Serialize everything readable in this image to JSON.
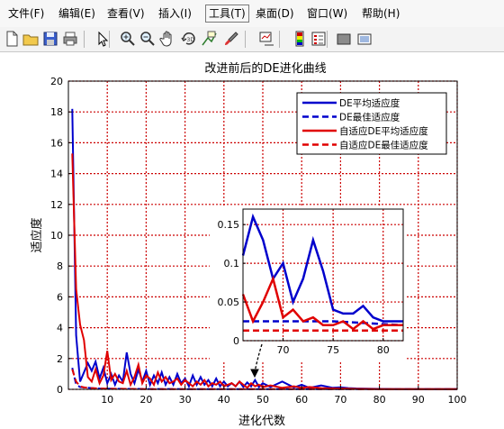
{
  "menu": {
    "items": [
      "文件(F)",
      "编辑(E)",
      "查看(V)",
      "插入(I)",
      "工具(T)",
      "桌面(D)",
      "窗口(W)",
      "帮助(H)"
    ],
    "active": "工具(T)"
  },
  "toolbar": {
    "icons": [
      "new-figure-icon",
      "open-file-icon",
      "save-icon",
      "print-icon",
      "select-arrow-icon",
      "zoom-in-icon",
      "zoom-out-icon",
      "pan-hand-icon",
      "rotate-3d-icon",
      "data-cursor-icon",
      "brush-icon",
      "link-plot-icon",
      "colorbar-icon",
      "legend-icon",
      "hide-plot-tools-icon",
      "show-plot-tools-icon"
    ]
  },
  "colors": {
    "blue": "#0000cc",
    "red": "#e00000",
    "grid": "#cc0000"
  },
  "chart_data": [
    {
      "type": "line",
      "title": "改进前后的DE进化曲线",
      "xlabel": "进化代数",
      "ylabel": "适应度",
      "xlim": [
        0,
        100
      ],
      "ylim": [
        0,
        20
      ],
      "xticks": [
        "10",
        "20",
        "30",
        "40",
        "50",
        "60",
        "70",
        "80",
        "90",
        "100"
      ],
      "yticks": [
        "0",
        "2",
        "4",
        "6",
        "8",
        "10",
        "12",
        "14",
        "16",
        "18",
        "20"
      ],
      "grid": true,
      "legend_position": "top-right",
      "series": [
        {
          "name": "DE平均适应度",
          "color": "#0000cc",
          "style": "solid",
          "x": [
            1,
            2,
            3,
            4,
            5,
            6,
            7,
            8,
            9,
            10,
            11,
            12,
            13,
            14,
            15,
            16,
            17,
            18,
            19,
            20,
            21,
            22,
            23,
            24,
            25,
            26,
            27,
            28,
            29,
            30,
            31,
            32,
            33,
            34,
            35,
            36,
            37,
            38,
            39,
            40,
            41,
            42,
            43,
            44,
            45,
            46,
            47,
            48,
            49,
            50,
            52,
            55,
            58,
            60,
            62,
            65,
            68,
            70,
            72,
            74,
            75,
            80,
            85,
            90,
            95,
            100
          ],
          "y": [
            18.2,
            3.5,
            0.5,
            1.1,
            1.7,
            1.2,
            1.8,
            0.7,
            1.4,
            0.4,
            1.0,
            0.3,
            0.9,
            0.5,
            2.4,
            1.0,
            0.4,
            1.3,
            0.5,
            1.2,
            0.3,
            0.9,
            0.4,
            1.1,
            0.3,
            0.8,
            0.3,
            1.0,
            0.4,
            0.7,
            0.2,
            0.9,
            0.3,
            0.8,
            0.3,
            0.6,
            0.2,
            0.7,
            0.2,
            0.5,
            0.2,
            0.4,
            0.2,
            0.5,
            0.15,
            0.45,
            0.2,
            0.6,
            0.15,
            0.4,
            0.15,
            0.5,
            0.12,
            0.3,
            0.1,
            0.25,
            0.1,
            0.13,
            0.08,
            0.06,
            0.05,
            0.03,
            0.02,
            0.02,
            0.01,
            0.01
          ]
        },
        {
          "name": "DE最佳适应度",
          "color": "#0000cc",
          "style": "dashed",
          "x": [
            1,
            2,
            3,
            5,
            8,
            10,
            15,
            20,
            30,
            50,
            70,
            100
          ],
          "y": [
            1.4,
            0.3,
            0.15,
            0.1,
            0.05,
            0.04,
            0.03,
            0.025,
            0.02,
            0.015,
            0.012,
            0.01
          ]
        },
        {
          "name": "自适应DE平均适应度",
          "color": "#e00000",
          "style": "solid",
          "x": [
            1,
            2,
            3,
            4,
            5,
            6,
            7,
            8,
            9,
            10,
            11,
            12,
            13,
            14,
            15,
            16,
            17,
            18,
            19,
            20,
            21,
            22,
            23,
            24,
            25,
            26,
            27,
            28,
            29,
            30,
            31,
            32,
            33,
            34,
            35,
            36,
            37,
            38,
            39,
            40,
            41,
            42,
            43,
            44,
            45,
            46,
            47,
            48,
            49,
            50,
            52,
            55,
            58,
            60,
            62,
            65,
            68,
            70,
            72,
            74,
            75,
            80,
            85,
            90,
            95,
            100
          ],
          "y": [
            15.3,
            6.5,
            4.2,
            3.2,
            0.8,
            0.5,
            1.3,
            0.4,
            0.9,
            2.5,
            0.6,
            1.0,
            0.5,
            0.4,
            1.2,
            0.3,
            0.8,
            1.6,
            0.4,
            0.9,
            0.7,
            0.3,
            1.1,
            0.5,
            0.8,
            0.4,
            0.5,
            0.7,
            0.3,
            0.6,
            0.4,
            0.2,
            0.5,
            0.3,
            0.6,
            0.2,
            0.4,
            0.3,
            0.5,
            0.2,
            0.3,
            0.4,
            0.2,
            0.5,
            0.3,
            0.1,
            0.4,
            0.2,
            0.3,
            0.15,
            0.25,
            0.1,
            0.2,
            0.1,
            0.15,
            0.08,
            0.06,
            0.05,
            0.04,
            0.03,
            0.03,
            0.02,
            0.015,
            0.01,
            0.01,
            0.01
          ]
        },
        {
          "name": "自适应DE最佳适应度",
          "color": "#e00000",
          "style": "dashed",
          "x": [
            1,
            2,
            3,
            4,
            6,
            8,
            10,
            15,
            20,
            30,
            50,
            70,
            100
          ],
          "y": [
            1.3,
            0.5,
            0.2,
            0.12,
            0.08,
            0.05,
            0.04,
            0.03,
            0.02,
            0.015,
            0.012,
            0.01,
            0.008
          ]
        }
      ]
    },
    {
      "type": "line",
      "title": "",
      "xlim": [
        66,
        82
      ],
      "ylim": [
        0,
        0.17
      ],
      "xticks": [
        "70",
        "75",
        "80"
      ],
      "yticks": [
        "0",
        "0.05",
        "0.1",
        "0.15"
      ],
      "grid": true,
      "series": [
        {
          "color": "#0000cc",
          "style": "solid",
          "x": [
            66,
            67,
            68,
            69,
            70,
            71,
            72,
            73,
            74,
            75,
            76,
            77,
            78,
            79,
            80,
            81,
            82
          ],
          "y": [
            0.11,
            0.16,
            0.13,
            0.08,
            0.1,
            0.05,
            0.08,
            0.13,
            0.09,
            0.04,
            0.035,
            0.035,
            0.045,
            0.03,
            0.025,
            0.025,
            0.025
          ]
        },
        {
          "color": "#0000cc",
          "style": "dashed",
          "x": [
            66,
            75,
            82
          ],
          "y": [
            0.025,
            0.025,
            0.02
          ]
        },
        {
          "color": "#e00000",
          "style": "solid",
          "x": [
            66,
            67,
            68,
            69,
            70,
            71,
            72,
            73,
            74,
            75,
            76,
            77,
            78,
            79,
            80,
            81,
            82
          ],
          "y": [
            0.06,
            0.025,
            0.05,
            0.08,
            0.03,
            0.04,
            0.025,
            0.03,
            0.02,
            0.02,
            0.025,
            0.015,
            0.025,
            0.015,
            0.02,
            0.02,
            0.02
          ]
        },
        {
          "color": "#e00000",
          "style": "dashed",
          "x": [
            66,
            82
          ],
          "y": [
            0.013,
            0.013
          ]
        }
      ]
    }
  ]
}
